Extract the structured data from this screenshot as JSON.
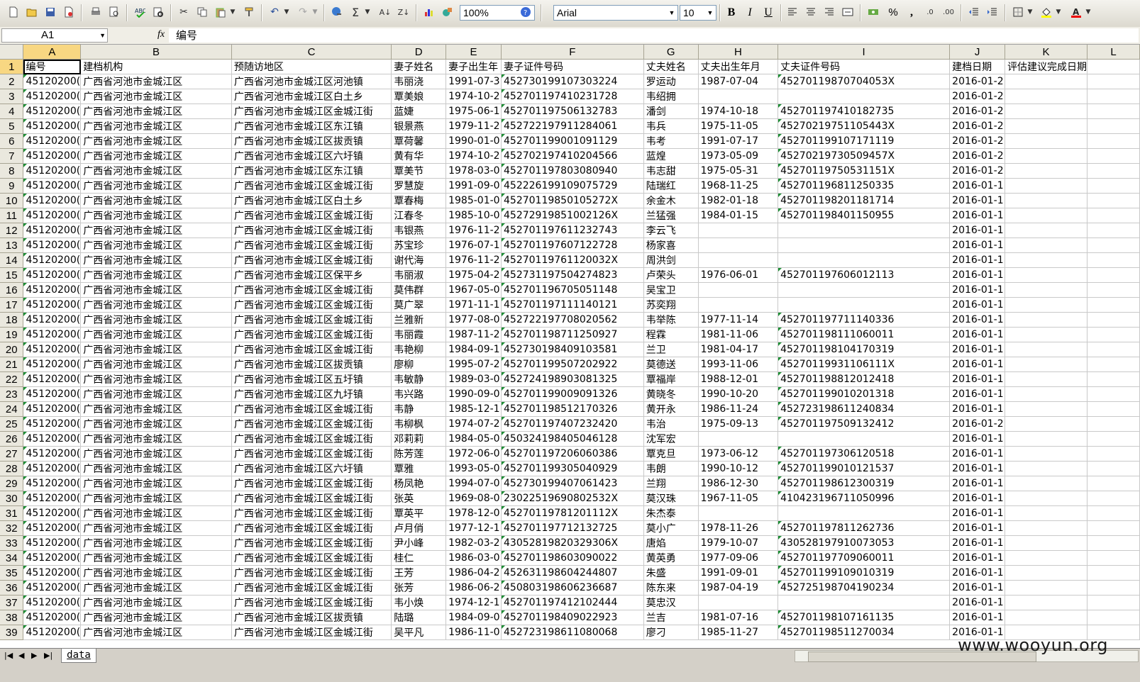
{
  "toolbar": {
    "zoom": "100%",
    "font_name": "Arial",
    "font_size": "10",
    "bold": "B",
    "italic": "I",
    "underline": "U",
    "percent": "%",
    "comma": ","
  },
  "formula_bar": {
    "cell_ref": "A1",
    "fx": "fx",
    "content": "编号"
  },
  "columns": [
    "A",
    "B",
    "C",
    "D",
    "E",
    "F",
    "G",
    "H",
    "I",
    "J",
    "K",
    "L"
  ],
  "rows": [
    [
      "编号",
      "建档机构",
      "预随访地区",
      "妻子姓名",
      "妻子出生年",
      "妻子证件号码",
      "丈夫姓名",
      "丈夫出生年月",
      "丈夫证件号码",
      "建档日期",
      "评估建议完成日期",
      ""
    ],
    [
      "45120200(",
      "广西省河池市金城江区",
      "广西省河池市金城江区河池镇",
      "韦丽浇",
      "1991-07-3",
      "452730199107303224",
      "罗运动",
      "1987-07-04",
      "45270119870704053X",
      "2016-01-2",
      "",
      ""
    ],
    [
      "45120200(",
      "广西省河池市金城江区",
      "广西省河池市金城江区白土乡",
      "覃美娘",
      "1974-10-2",
      "452701197410231728",
      "韦绍拥",
      "",
      "",
      "2016-01-2",
      "",
      ""
    ],
    [
      "45120200(",
      "广西省河池市金城江区",
      "广西省河池市金城江区金城江街",
      "蓝婕",
      "1975-06-1",
      "452701197506132783",
      "潘剑",
      "1974-10-18",
      "452701197410182735",
      "2016-01-2",
      "",
      ""
    ],
    [
      "45120200(",
      "广西省河池市金城江区",
      "广西省河池市金城江区东江镇",
      "银景燕",
      "1979-11-2",
      "452722197911284061",
      "韦兵",
      "1975-11-05",
      "45270219751105443X",
      "2016-01-2",
      "",
      ""
    ],
    [
      "45120200(",
      "广西省河池市金城江区",
      "广西省河池市金城江区拔贡镇",
      "覃荷馨",
      "1990-01-0",
      "452701199001091129",
      "韦考",
      "1991-07-17",
      "452701199107171119",
      "2016-01-2",
      "",
      ""
    ],
    [
      "45120200(",
      "广西省河池市金城江区",
      "广西省河池市金城江区六圩镇",
      "黄有华",
      "1974-10-2",
      "452702197410204566",
      "蓝煌",
      "1973-05-09",
      "45270219730509457X",
      "2016-01-2",
      "",
      ""
    ],
    [
      "45120200(",
      "广西省河池市金城江区",
      "广西省河池市金城江区东江镇",
      "覃美节",
      "1978-03-0",
      "452701197803080940",
      "韦志甜",
      "1975-05-31",
      "45270119750531151X",
      "2016-01-2",
      "",
      ""
    ],
    [
      "45120200(",
      "广西省河池市金城江区",
      "广西省河池市金城江区金城江街",
      "罗慧旋",
      "1991-09-0",
      "452226199109075729",
      "陆瑞红",
      "1968-11-25",
      "452701196811250335",
      "2016-01-1",
      "",
      ""
    ],
    [
      "45120200(",
      "广西省河池市金城江区",
      "广西省河池市金城江区白土乡",
      "覃春梅",
      "1985-01-0",
      "45270119850105272X",
      "余金木",
      "1982-01-18",
      "452701198201181714",
      "2016-01-1",
      "",
      ""
    ],
    [
      "45120200(",
      "广西省河池市金城江区",
      "广西省河池市金城江区金城江街",
      "江春冬",
      "1985-10-0",
      "45272919851002126X",
      "兰猛强",
      "1984-01-15",
      "452701198401150955",
      "2016-01-1",
      "",
      ""
    ],
    [
      "45120200(",
      "广西省河池市金城江区",
      "广西省河池市金城江区金城江街",
      "韦银燕",
      "1976-11-2",
      "452701197611232743",
      "李云飞",
      "",
      "",
      "2016-01-1",
      "",
      ""
    ],
    [
      "45120200(",
      "广西省河池市金城江区",
      "广西省河池市金城江区金城江街",
      "苏宝珍",
      "1976-07-1",
      "452701197607122728",
      "杨家喜",
      "",
      "",
      "2016-01-1",
      "",
      ""
    ],
    [
      "45120200(",
      "广西省河池市金城江区",
      "广西省河池市金城江区金城江街",
      "谢代海",
      "1976-11-2",
      "45270119761120032X",
      "周洪剑",
      "",
      "",
      "2016-01-1",
      "",
      ""
    ],
    [
      "45120200(",
      "广西省河池市金城江区",
      "广西省河池市金城江区保平乡",
      "韦丽淑",
      "1975-04-2",
      "452731197504274823",
      "卢荣头",
      "1976-06-01",
      "452701197606012113",
      "2016-01-1",
      "",
      ""
    ],
    [
      "45120200(",
      "广西省河池市金城江区",
      "广西省河池市金城江区金城江街",
      "莫伟群",
      "1967-05-0",
      "452701196705051148",
      "吴宝卫",
      "",
      "",
      "2016-01-1",
      "",
      ""
    ],
    [
      "45120200(",
      "广西省河池市金城江区",
      "广西省河池市金城江区金城江街",
      "莫广翠",
      "1971-11-1",
      "452701197111140121",
      "苏奕翔",
      "",
      "",
      "2016-01-1",
      "",
      ""
    ],
    [
      "45120200(",
      "广西省河池市金城江区",
      "广西省河池市金城江区金城江街",
      "兰雅新",
      "1977-08-0",
      "452722197708020562",
      "韦举陈",
      "1977-11-14",
      "452701197711140336",
      "2016-01-1",
      "",
      ""
    ],
    [
      "45120200(",
      "广西省河池市金城江区",
      "广西省河池市金城江区金城江街",
      "韦丽霞",
      "1987-11-2",
      "452701198711250927",
      "程霖",
      "1981-11-06",
      "452701198111060011",
      "2016-01-1",
      "",
      ""
    ],
    [
      "45120200(",
      "广西省河池市金城江区",
      "广西省河池市金城江区金城江街",
      "韦艳柳",
      "1984-09-1",
      "452730198409103581",
      "兰卫",
      "1981-04-17",
      "452701198104170319",
      "2016-01-1",
      "",
      ""
    ],
    [
      "45120200(",
      "广西省河池市金城江区",
      "广西省河池市金城江区拔贡镇",
      "廖柳",
      "1995-07-2",
      "452701199507202922",
      "莫德送",
      "1993-11-06",
      "45270119931106111X",
      "2016-01-1",
      "",
      ""
    ],
    [
      "45120200(",
      "广西省河池市金城江区",
      "广西省河池市金城江区五圩镇",
      "韦敏静",
      "1989-03-0",
      "452724198903081325",
      "覃福岸",
      "1988-12-01",
      "452701198812012418",
      "2016-01-1",
      "",
      ""
    ],
    [
      "45120200(",
      "广西省河池市金城江区",
      "广西省河池市金城江区九圩镇",
      "韦兴路",
      "1990-09-0",
      "452701199009091326",
      "黄晓冬",
      "1990-10-20",
      "452701199010201318",
      "2016-01-1",
      "",
      ""
    ],
    [
      "45120200(",
      "广西省河池市金城江区",
      "广西省河池市金城江区金城江街",
      "韦静",
      "1985-12-1",
      "452701198512170326",
      "黄开永",
      "1986-11-24",
      "452723198611240834",
      "2016-01-1",
      "",
      ""
    ],
    [
      "45120200(",
      "广西省河池市金城江区",
      "广西省河池市金城江区金城江街",
      "韦柳枫",
      "1974-07-2",
      "452701197407232420",
      "韦治",
      "1975-09-13",
      "452701197509132412",
      "2016-01-2",
      "",
      ""
    ],
    [
      "45120200(",
      "广西省河池市金城江区",
      "广西省河池市金城江区金城江街",
      "邓莉莉",
      "1984-05-0",
      "450324198405046128",
      "沈军宏",
      "",
      "",
      "2016-01-1",
      "",
      ""
    ],
    [
      "45120200(",
      "广西省河池市金城江区",
      "广西省河池市金城江区金城江街",
      "陈芳莲",
      "1972-06-0",
      "452701197206060386",
      "覃克旦",
      "1973-06-12",
      "452701197306120518",
      "2016-01-1",
      "",
      ""
    ],
    [
      "45120200(",
      "广西省河池市金城江区",
      "广西省河池市金城江区六圩镇",
      "覃雅",
      "1993-05-0",
      "452701199305040929",
      "韦朗",
      "1990-10-12",
      "452701199010121537",
      "2016-01-1",
      "",
      ""
    ],
    [
      "45120200(",
      "广西省河池市金城江区",
      "广西省河池市金城江区金城江街",
      "杨凤艳",
      "1994-07-0",
      "452730199407061423",
      "兰翔",
      "1986-12-30",
      "452701198612300319",
      "2016-01-1",
      "",
      ""
    ],
    [
      "45120200(",
      "广西省河池市金城江区",
      "广西省河池市金城江区金城江街",
      "张英",
      "1969-08-0",
      "23022519690802532X",
      "莫汉珠",
      "1967-11-05",
      "410423196711050996",
      "2016-01-1",
      "",
      ""
    ],
    [
      "45120200(",
      "广西省河池市金城江区",
      "广西省河池市金城江区金城江街",
      "覃英平",
      "1978-12-0",
      "45270119781201112X",
      "朱杰泰",
      "",
      "",
      "2016-01-1",
      "",
      ""
    ],
    [
      "45120200(",
      "广西省河池市金城江区",
      "广西省河池市金城江区金城江街",
      "卢月俏",
      "1977-12-1",
      "452701197712132725",
      "莫小广",
      "1978-11-26",
      "452701197811262736",
      "2016-01-1",
      "",
      ""
    ],
    [
      "45120200(",
      "广西省河池市金城江区",
      "广西省河池市金城江区金城江街",
      "尹小峰",
      "1982-03-2",
      "43052819820329306X",
      "唐焰",
      "1979-10-07",
      "430528197910073053",
      "2016-01-1",
      "",
      ""
    ],
    [
      "45120200(",
      "广西省河池市金城江区",
      "广西省河池市金城江区金城江街",
      "桂仁",
      "1986-03-0",
      "452701198603090022",
      "黄英勇",
      "1977-09-06",
      "452701197709060011",
      "2016-01-1",
      "",
      ""
    ],
    [
      "45120200(",
      "广西省河池市金城江区",
      "广西省河池市金城江区金城江街",
      "王芳",
      "1986-04-2",
      "452631198604244807",
      "朱盛",
      "1991-09-01",
      "452701199109010319",
      "2016-01-1",
      "",
      ""
    ],
    [
      "45120200(",
      "广西省河池市金城江区",
      "广西省河池市金城江区金城江街",
      "张芳",
      "1986-06-2",
      "450803198606236687",
      "陈东来",
      "1987-04-19",
      "452725198704190234",
      "2016-01-1",
      "",
      ""
    ],
    [
      "45120200(",
      "广西省河池市金城江区",
      "广西省河池市金城江区金城江街",
      "韦小焕",
      "1974-12-1",
      "452701197412102444",
      "莫忠汉",
      "",
      "",
      "2016-01-1",
      "",
      ""
    ],
    [
      "45120200(",
      "广西省河池市金城江区",
      "广西省河池市金城江区拔贡镇",
      "陆璐",
      "1984-09-0",
      "452701198409022923",
      "兰吉",
      "1981-07-16",
      "452701198107161135",
      "2016-01-1",
      "",
      ""
    ],
    [
      "45120200(",
      "广西省河池市金城江区",
      "广西省河池市金城江区金城江街",
      "吴平凡",
      "1986-11-0",
      "452723198611080068",
      "廖刁",
      "1985-11-27",
      "452701198511270034",
      "2016-01-1",
      "",
      ""
    ]
  ],
  "sheet_tabs": [
    "data"
  ],
  "watermark": "www.wooyun.org",
  "colors": {
    "selected_header": "#f8d782",
    "text_marker": "#1d8d34",
    "gridline": "#c9c9c9"
  }
}
